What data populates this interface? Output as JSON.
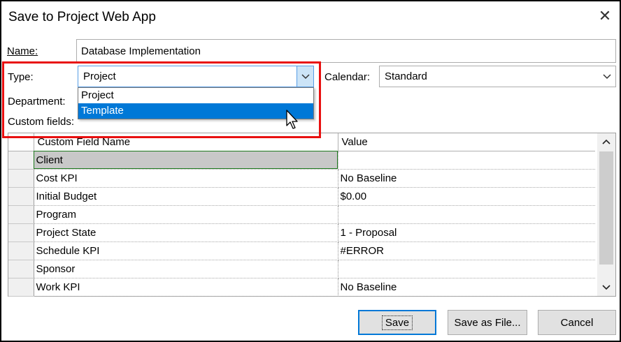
{
  "dialog": {
    "title": "Save to Project Web App",
    "close_glyph": "✕"
  },
  "form": {
    "name_label": "Name:",
    "name_value": "Database Implementation",
    "type_label": "Type:",
    "type_value": "Project",
    "calendar_label": "Calendar:",
    "calendar_value": "Standard",
    "department_label": "Department:",
    "custom_fields_label": "Custom fields:"
  },
  "type_dropdown": {
    "options": [
      "Project",
      "Template"
    ],
    "highlighted": "Template"
  },
  "grid": {
    "columns": [
      "Custom Field Name",
      "Value"
    ],
    "rows": [
      {
        "name": "Client",
        "value": ""
      },
      {
        "name": "Cost KPI",
        "value": "No Baseline"
      },
      {
        "name": "Initial Budget",
        "value": "$0.00"
      },
      {
        "name": "Program",
        "value": ""
      },
      {
        "name": "Project State",
        "value": "1 - Proposal"
      },
      {
        "name": "Schedule KPI",
        "value": "#ERROR"
      },
      {
        "name": "Sponsor",
        "value": ""
      },
      {
        "name": "Work KPI",
        "value": "No Baseline"
      }
    ],
    "active_row": "Client"
  },
  "buttons": {
    "save": "Save",
    "save_as_file": "Save as File...",
    "cancel": "Cancel"
  },
  "colors": {
    "highlight_box": "#e81010",
    "selection_blue": "#0078d7",
    "arrow_active_bg": "#cce4f7"
  },
  "icons": {
    "close": "close-icon",
    "type_arrow": "chevron-down-icon",
    "calendar_arrow": "chevron-down-icon",
    "scroll_up": "scroll-up-arrow-icon",
    "scroll_down": "scroll-down-arrow-icon",
    "cursor": "mouse-pointer-icon"
  }
}
